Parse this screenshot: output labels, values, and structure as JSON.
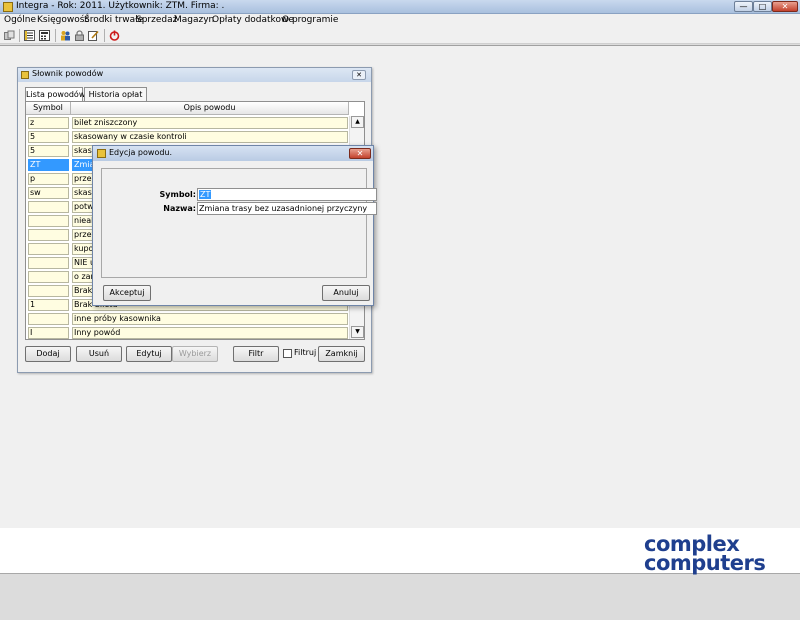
{
  "app": {
    "title": "Integra - Rok: 2011. Użytkownik: ZTM. Firma: ."
  },
  "window_controls": {
    "minimize": "—",
    "maximize": "□",
    "close": "✕"
  },
  "menu": {
    "items": [
      "Ogólne",
      "Księgowość",
      "Środki trwałe",
      "Sprzedaż",
      "Magazyn",
      "Opłaty dodatkowe",
      "O programie"
    ]
  },
  "toolbar": {
    "icons": [
      "copy-icon",
      "list-icon",
      "calculator-icon",
      "users-icon",
      "lock-icon",
      "edit-icon",
      "power-icon"
    ]
  },
  "slownik": {
    "title": "Słownik powodów",
    "close": "✕",
    "tabs": [
      "Lista powodów",
      "Historia opłat"
    ],
    "columns": [
      "Symbol",
      "Opis powodu"
    ],
    "rows": [
      {
        "symbol": "z",
        "opis": "bilet zniszczony"
      },
      {
        "symbol": "5",
        "opis": "skasowany w czasie kontroli"
      },
      {
        "symbol": "5",
        "opis": "skaso"
      },
      {
        "symbol": "ZT",
        "opis": "Zmian"
      },
      {
        "symbol": "p",
        "opis": "przek"
      },
      {
        "symbol": "sw",
        "opis": "skaso"
      },
      {
        "symbol": "",
        "opis": "potwie"
      },
      {
        "symbol": "",
        "opis": "nieakt"
      },
      {
        "symbol": "",
        "opis": "przew"
      },
      {
        "symbol": "",
        "opis": "kupon"
      },
      {
        "symbol": "",
        "opis": "NIE u"
      },
      {
        "symbol": "",
        "opis": "o zan"
      },
      {
        "symbol": "",
        "opis": "Brak"
      },
      {
        "symbol": "1",
        "opis": "Brak biletu"
      },
      {
        "symbol": "",
        "opis": "inne próby kasownika"
      },
      {
        "symbol": "I",
        "opis": "Inny powód"
      }
    ],
    "selected_row": 3,
    "scroll_up": "▲",
    "scroll_down": "▼",
    "buttons": {
      "dodaj": "Dodaj",
      "usun": "Usuń",
      "edytuj": "Edytuj",
      "wybierz": "Wybierz",
      "filtr": "Filtr",
      "filtruj": "Filtruj",
      "zamknij": "Zamknij"
    }
  },
  "edycja": {
    "title": "Edycja powodu.",
    "close": "✕",
    "symbol_label": "Symbol:",
    "symbol_value": "ZT",
    "nazwa_label": "Nazwa:",
    "nazwa_value": "Zmiana trasy bez uzasadnionej przyczyny",
    "akceptuj": "Akceptuj",
    "anuluj": "Anuluj"
  },
  "logo": {
    "line1": "complex",
    "line2": "computers",
    "color": "#1f3f8e"
  }
}
